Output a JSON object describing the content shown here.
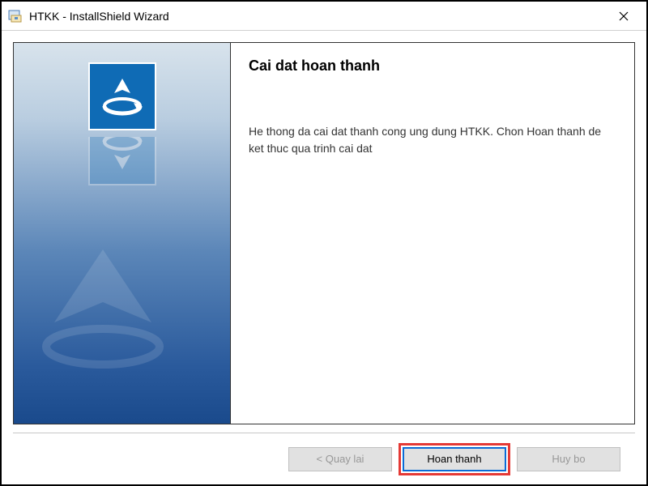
{
  "titlebar": {
    "title": "HTKK - InstallShield Wizard"
  },
  "content": {
    "heading": "Cai dat hoan thanh",
    "body": "He thong da cai dat thanh cong ung dung HTKK. Chon Hoan thanh de ket thuc qua trinh  cai dat"
  },
  "buttons": {
    "back": "< Quay lai",
    "finish": "Hoan thanh",
    "cancel": "Huy bo"
  }
}
